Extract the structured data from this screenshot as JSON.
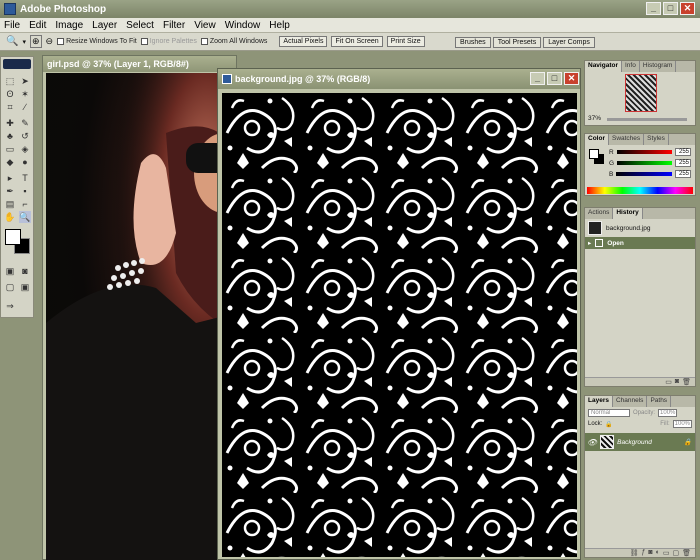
{
  "app": {
    "title": "Adobe Photoshop",
    "window_buttons": [
      "_",
      "□",
      "✕"
    ]
  },
  "menu": [
    "File",
    "Edit",
    "Image",
    "Layer",
    "Select",
    "Filter",
    "View",
    "Window",
    "Help"
  ],
  "options_bar": {
    "resize_windows_label": "Resize Windows To Fit",
    "ignore_palettes_label": "Ignore Palettes",
    "zoom_all_label": "Zoom All Windows",
    "actual_pixels": "Actual Pixels",
    "fit_on_screen": "Fit On Screen",
    "print_size": "Print Size",
    "palette_well": [
      "Brushes",
      "Tool Presets",
      "Layer Comps"
    ]
  },
  "documents": [
    {
      "title": "girl.psd @ 37% (Layer 1, RGB/8#)"
    },
    {
      "title": "background.jpg @ 37% (RGB/8)"
    }
  ],
  "navigator": {
    "tabs": [
      "Navigator",
      "Info",
      "Histogram"
    ],
    "zoom": "37%"
  },
  "color_panel": {
    "tabs": [
      "Color",
      "Swatches",
      "Styles"
    ],
    "channels": [
      {
        "label": "R",
        "value": "255"
      },
      {
        "label": "G",
        "value": "255"
      },
      {
        "label": "B",
        "value": "255"
      }
    ]
  },
  "history_panel": {
    "tabs": [
      "Actions",
      "History"
    ],
    "snapshot": "background.jpg",
    "states": [
      "Open"
    ]
  },
  "layers_panel": {
    "tabs": [
      "Layers",
      "Channels",
      "Paths"
    ],
    "blend_mode": "Normal",
    "opacity_label": "Opacity:",
    "opacity_value": "100%",
    "lock_label": "Lock:",
    "fill_label": "Fill:",
    "fill_value": "100%",
    "layers": [
      {
        "name": "Background"
      }
    ]
  },
  "colors": {
    "accent": "#6a7a52",
    "titlebar": "#8a9273",
    "close": "#c8412d"
  }
}
